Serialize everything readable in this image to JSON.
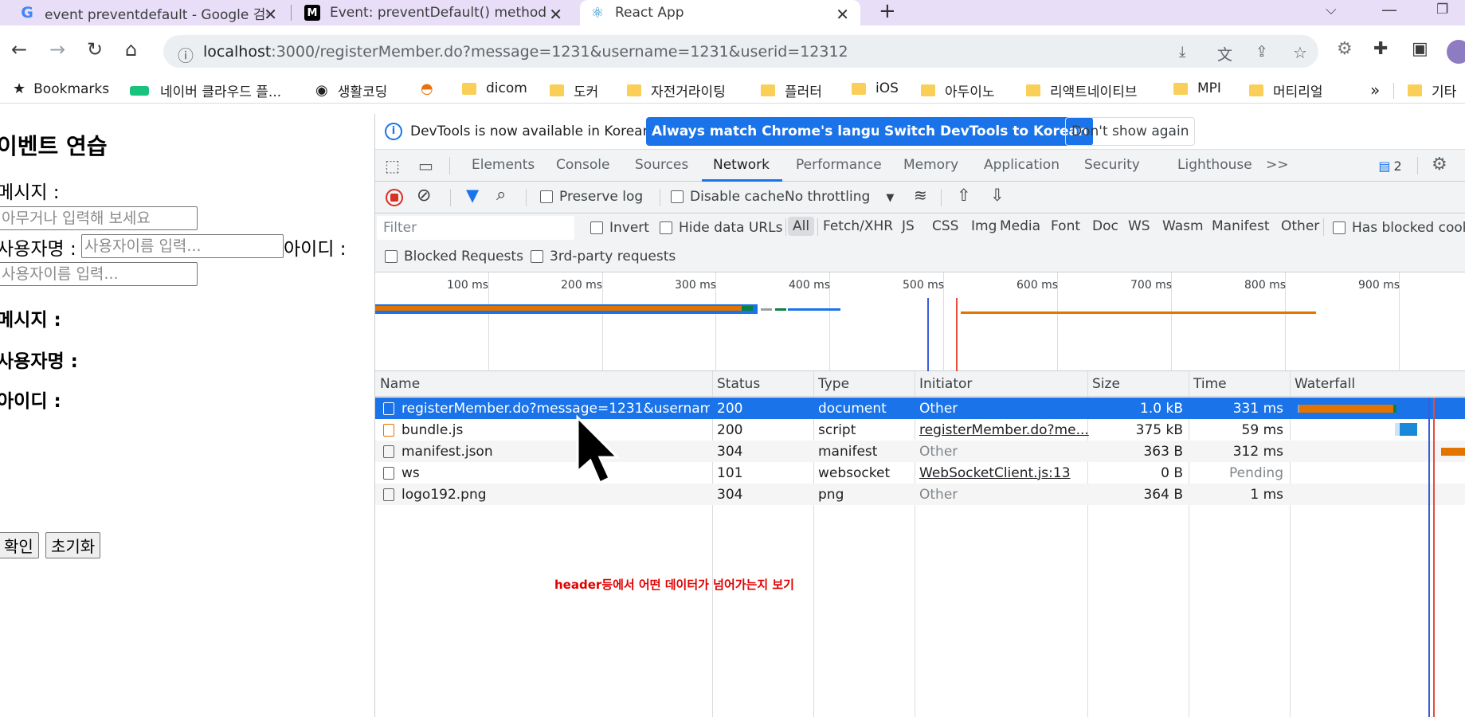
{
  "browser": {
    "tabs": [
      {
        "title": "event preventdefault - Google 검색",
        "favicon": "google-icon"
      },
      {
        "title": "Event: preventDefault() method",
        "favicon": "mdn-icon"
      },
      {
        "title": "React App",
        "favicon": "react-icon",
        "active": true
      }
    ],
    "new_tab_label": "+",
    "url_host": "localhost",
    "url_rest": ":3000/registerMember.do?message=1231&username=1231&userid=12312"
  },
  "bookmarks": {
    "items": [
      {
        "label": "Bookmarks",
        "icon": "star-icon"
      },
      {
        "label": "네이버 클라우드 플...",
        "icon": "naver-cloud-icon"
      },
      {
        "label": "생활코딩",
        "icon": "globe-icon"
      },
      {
        "label": "",
        "icon": "rainbow-icon"
      },
      {
        "label": "dicom",
        "icon": "folder-icon"
      },
      {
        "label": "도커",
        "icon": "folder-icon"
      },
      {
        "label": "자전거라이팅",
        "icon": "folder-icon"
      },
      {
        "label": "플러터",
        "icon": "folder-icon"
      },
      {
        "label": "iOS",
        "icon": "folder-icon"
      },
      {
        "label": "아두이노",
        "icon": "folder-icon"
      },
      {
        "label": "리액트네이티브",
        "icon": "folder-icon"
      },
      {
        "label": "MPI",
        "icon": "folder-icon"
      },
      {
        "label": "머티리얼",
        "icon": "folder-icon"
      },
      {
        "label": "기타",
        "icon": "folder-icon"
      }
    ],
    "overflow_label": "»"
  },
  "page": {
    "title": "이벤트 연습",
    "message_label": "메시지 :",
    "message_placeholder": "아무거나 입력해 보세요",
    "username_label": "사용자명 :",
    "username_placeholder": "사용자이름 입력...",
    "userid_label": "아이디 :",
    "userid_placeholder": "사용자이름 입력...",
    "result_message_label": "메시지 :",
    "result_username_label": "사용자명 :",
    "result_userid_label": "아이디 :",
    "confirm_button": "확인",
    "reset_button": "초기화"
  },
  "devtools": {
    "infobar": {
      "text": "DevTools is now available in Korean!",
      "match_language_button": "Always match Chrome's language",
      "switch_button": "Switch DevTools to Korean",
      "dismiss_button": "Don't show again"
    },
    "tabs": [
      "Elements",
      "Console",
      "Sources",
      "Network",
      "Performance",
      "Memory",
      "Application",
      "Security",
      "Lighthouse"
    ],
    "active_tab": "Network",
    "more_tabs": ">>",
    "issues_count": "2",
    "toolbar": {
      "preserve_log": "Preserve log",
      "disable_cache": "Disable cache",
      "throttling": "No throttling"
    },
    "filter": {
      "placeholder": "Filter",
      "invert": "Invert",
      "hide_data_urls": "Hide data URLs",
      "types": [
        "All",
        "Fetch/XHR",
        "JS",
        "CSS",
        "Img",
        "Media",
        "Font",
        "Doc",
        "WS",
        "Wasm",
        "Manifest",
        "Other"
      ],
      "has_blocked_cookies": "Has blocked cookies",
      "blocked_requests": "Blocked Requests",
      "third_party": "3rd-party requests"
    },
    "timeline_ticks": [
      "100 ms",
      "200 ms",
      "300 ms",
      "400 ms",
      "500 ms",
      "600 ms",
      "700 ms",
      "800 ms",
      "900 ms"
    ],
    "columns": [
      "Name",
      "Status",
      "Type",
      "Initiator",
      "Size",
      "Time",
      "Waterfall"
    ],
    "requests": [
      {
        "name": "registerMember.do?message=1231&usernam...",
        "status": "200",
        "type": "document",
        "initiator": "Other",
        "size": "1.0 kB",
        "time": "331 ms",
        "icon": "document-icon"
      },
      {
        "name": "bundle.js",
        "status": "200",
        "type": "script",
        "initiator": "registerMember.do?me...",
        "size": "375 kB",
        "time": "59 ms",
        "icon": "script-icon"
      },
      {
        "name": "manifest.json",
        "status": "304",
        "type": "manifest",
        "initiator": "Other",
        "size": "363 B",
        "time": "312 ms",
        "icon": "file-icon"
      },
      {
        "name": "ws",
        "status": "101",
        "type": "websocket",
        "initiator": "WebSocketClient.js:13",
        "size": "0 B",
        "time": "Pending",
        "icon": "file-icon"
      },
      {
        "name": "logo192.png",
        "status": "304",
        "type": "png",
        "initiator": "Other",
        "size": "364 B",
        "time": "1 ms",
        "icon": "file-icon"
      }
    ]
  },
  "annotation": "header등에서 어떤 데이터가 넘어가는지 보기",
  "colors": {
    "accent": "#1a73e8",
    "tab_strip": "#e8def8",
    "waterfall_orange": "#e37400",
    "annotation": "#e00000"
  }
}
